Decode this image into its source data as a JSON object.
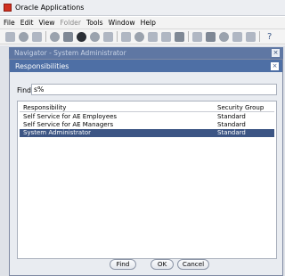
{
  "app": {
    "title": "Oracle Applications"
  },
  "menubar": [
    "File",
    "Edit",
    "View",
    "Folder",
    "Tools",
    "Window",
    "Help"
  ],
  "menubar_disabled": [
    "Folder"
  ],
  "toolbar": {
    "help_label": "?"
  },
  "navigator": {
    "title": "Navigator - System Administrator",
    "close_label": "×"
  },
  "dialog": {
    "title": "Responsibilities",
    "close_label": "×",
    "find_label": "Find",
    "find_value": "s%",
    "columns": [
      "Responsibility",
      "Security Group"
    ],
    "rows": [
      {
        "responsibility": "Self Service for AE Employees",
        "security_group": "Standard"
      },
      {
        "responsibility": "Self Service for AE Managers",
        "security_group": "Standard"
      },
      {
        "responsibility": "System Administrator",
        "security_group": "Standard"
      }
    ],
    "buttons": {
      "find": "Find",
      "ok": "OK",
      "cancel": "Cancel"
    }
  },
  "colors": {
    "dialog_title_bg": "#4e6fa5",
    "selection_bg": "#3c5584"
  }
}
